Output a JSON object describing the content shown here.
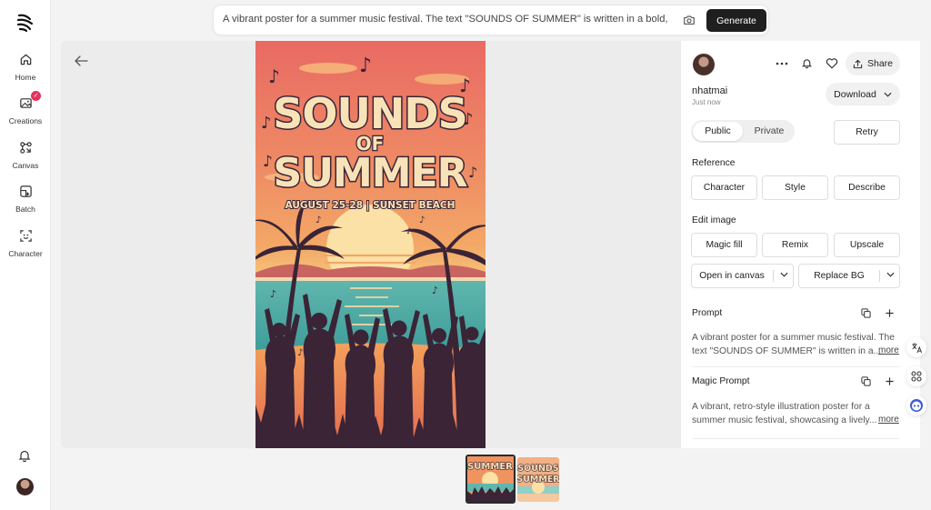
{
  "sidebar": {
    "items": [
      {
        "label": "Home",
        "icon": "home-icon"
      },
      {
        "label": "Creations",
        "icon": "images-icon",
        "badge": "✓"
      },
      {
        "label": "Canvas",
        "icon": "canvas-icon"
      },
      {
        "label": "Batch",
        "icon": "batch-icon"
      },
      {
        "label": "Character",
        "icon": "character-icon"
      }
    ]
  },
  "prompt_bar": {
    "value": "A vibrant poster for a summer music festival. The text \"SOUNDS OF SUMMER\" is written in a bold,",
    "generate_label": "Generate"
  },
  "poster": {
    "title_line1": "SOUNDS",
    "title_line2": "OF",
    "title_line3": "SUMMER",
    "subtitle": "AUGUST 25-28 | SUNSET BEACH"
  },
  "panel": {
    "share_label": "Share",
    "username": "nhatmai",
    "timestamp": "Just now",
    "download_label": "Download",
    "visibility": {
      "public": "Public",
      "private": "Private"
    },
    "retry_label": "Retry",
    "reference": {
      "title": "Reference",
      "buttons": [
        "Character",
        "Style",
        "Describe"
      ]
    },
    "edit_image": {
      "title": "Edit image",
      "buttons": [
        "Magic fill",
        "Remix",
        "Upscale"
      ],
      "open_in_canvas": "Open in canvas",
      "replace_bg": "Replace BG"
    },
    "prompt": {
      "title": "Prompt",
      "line1": "A vibrant poster for a summer music festival. The",
      "line2": "text \"SOUNDS OF SUMMER\" is written in a...",
      "more": "more"
    },
    "magic_prompt": {
      "title": "Magic Prompt",
      "line1": "A vibrant, retro-style illustration poster for a",
      "line2": "summer music festival, showcasing a lively...",
      "more": "more"
    }
  },
  "thumbnails": {
    "first": {
      "line1": "SUMMER"
    },
    "second": {
      "line1": "SOUNDS",
      "line2": "SUMMER"
    }
  },
  "colors": {
    "accent_dark": "#1f1f1f",
    "badge": "#e2335e",
    "float_face": "#3b5bdb"
  }
}
